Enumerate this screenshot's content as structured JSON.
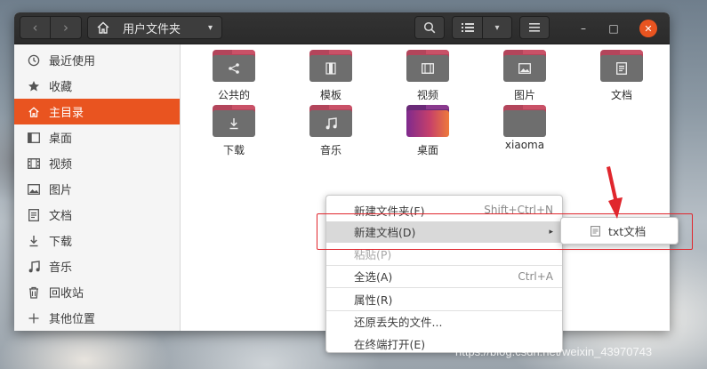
{
  "headerbar": {
    "back_glyph": "‹",
    "forward_glyph": "›",
    "path_label": "用户文件夹",
    "path_caret": "▾",
    "view_caret": "▾",
    "min_glyph": "–",
    "max_glyph": "□",
    "close_glyph": "✕",
    "accent": "#e95420"
  },
  "sidebar": {
    "items": [
      {
        "label": "最近使用",
        "icon": "clock-icon",
        "active": false
      },
      {
        "label": "收藏",
        "icon": "star-icon",
        "active": false
      },
      {
        "label": "主目录",
        "icon": "home-icon",
        "active": true
      },
      {
        "label": "桌面",
        "icon": "desktop-icon",
        "active": false
      },
      {
        "label": "视频",
        "icon": "film-icon",
        "active": false
      },
      {
        "label": "图片",
        "icon": "image-icon",
        "active": false
      },
      {
        "label": "文档",
        "icon": "document-icon",
        "active": false
      },
      {
        "label": "下载",
        "icon": "download-icon",
        "active": false
      },
      {
        "label": "音乐",
        "icon": "music-icon",
        "active": false
      },
      {
        "label": "回收站",
        "icon": "trash-icon",
        "active": false
      },
      {
        "label": "其他位置",
        "icon": "plus-icon",
        "active": false
      }
    ]
  },
  "files": [
    {
      "label": "公共的",
      "emblem": "share-icon"
    },
    {
      "label": "模板",
      "emblem": "template-icon"
    },
    {
      "label": "视频",
      "emblem": "film-icon"
    },
    {
      "label": "图片",
      "emblem": "image-icon"
    },
    {
      "label": "文档",
      "emblem": "document-icon"
    },
    {
      "label": "下载",
      "emblem": "download-icon"
    },
    {
      "label": "音乐",
      "emblem": "music-icon"
    },
    {
      "label": "桌面",
      "emblem": "desktop-gradient"
    },
    {
      "label": "xiaoma",
      "emblem": "none"
    }
  ],
  "context_menu": {
    "new_folder": {
      "label": "新建文件夹(F)",
      "accel": "Shift+Ctrl+N"
    },
    "new_document": {
      "label": "新建文档(D)",
      "arrow": "▸"
    },
    "paste": {
      "label": "粘贴(P)"
    },
    "select_all": {
      "label": "全选(A)",
      "accel": "Ctrl+A"
    },
    "properties": {
      "label": "属性(R)"
    },
    "restore_missing": {
      "label": "还原丢失的文件..."
    },
    "open_terminal": {
      "label": "在终端打开(E)"
    }
  },
  "submenu": {
    "label": "txt文档"
  },
  "watermark": "https://blog.csdn.net/weixin_43970743",
  "annotation_color": "#e0262d"
}
